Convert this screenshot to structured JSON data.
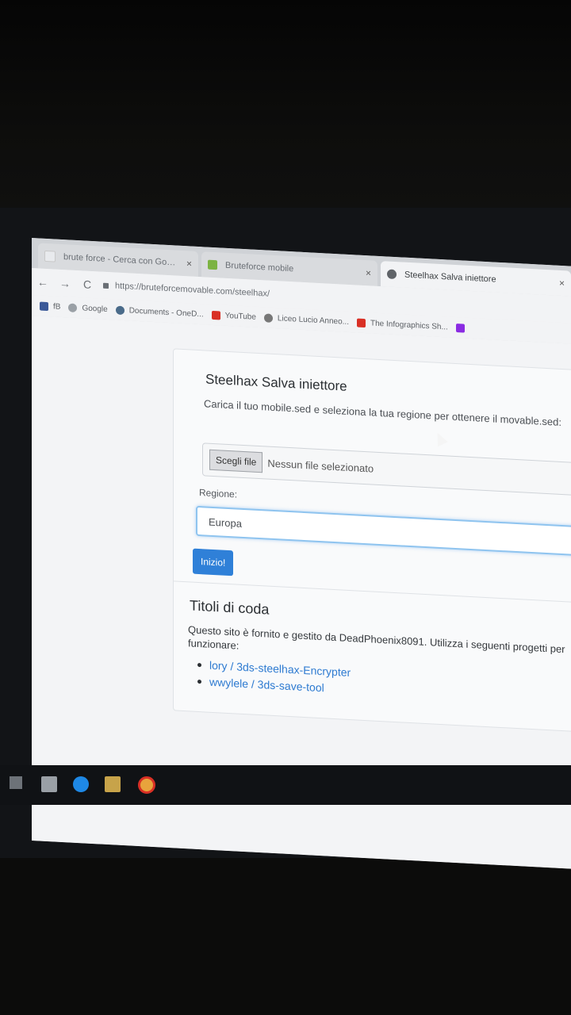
{
  "browser": {
    "tabs": [
      {
        "label": "brute force - Cerca con Google",
        "close": "×",
        "active": false
      },
      {
        "label": "Bruteforce mobile",
        "close": "×",
        "active": false
      },
      {
        "label": "Steelhax Salva iniettore",
        "close": "×",
        "active": true
      }
    ],
    "nav": {
      "back": "←",
      "forward": "→",
      "reload": "C"
    },
    "url": "https://bruteforcemovable.com/steelhax/",
    "bookmarks": [
      {
        "label": "fB",
        "icon": "facebook-icon",
        "color": "#3b5998"
      },
      {
        "label": "Google",
        "icon": "google-icon",
        "color": "#777777"
      },
      {
        "label": "Documents - OneD...",
        "icon": "onedrive-icon",
        "color": "#4a6b8a"
      },
      {
        "label": "YouTube",
        "icon": "youtube-icon",
        "color": "#d93025"
      },
      {
        "label": "Liceo Lucio Anneo...",
        "icon": "site-icon",
        "color": "#777777"
      },
      {
        "label": "The Infographics Sh...",
        "icon": "youtube-icon",
        "color": "#d93025"
      },
      {
        "label": "",
        "icon": "wp-icon",
        "color": "#8a2be2"
      }
    ]
  },
  "page": {
    "title": "Steelhax Salva iniettore",
    "description": "Carica il tuo mobile.sed e seleziona la tua regione per ottenere il movable.sed:",
    "file_button": "Scegli file",
    "file_status": "Nessun file selezionato",
    "region_label": "Regione:",
    "region_value": "Europa",
    "start_button": "Inizio!",
    "credits_title": "Titoli di coda",
    "credits_text": "Questo sito è fornito e gestito da DeadPhoenix8091. Utilizza i seguenti progetti per funzionare:",
    "links": [
      "lory / 3ds-steelhax-Encrypter",
      "wwylele / 3ds-save-tool"
    ]
  },
  "colors": {
    "accent": "#2f80d8",
    "link": "#2e7bd1",
    "focus_border": "#8fc4ef"
  }
}
